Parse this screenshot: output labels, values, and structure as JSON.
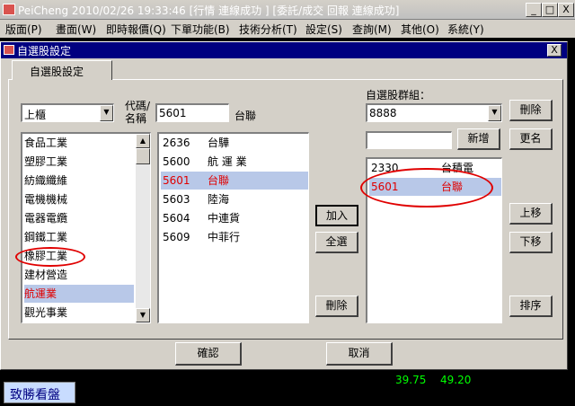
{
  "app": {
    "title": "PeiCheng 2010/02/26 19:33:46 [行情  連線成功 ] [委託/成交 回報  連線成功]",
    "minimize": "_",
    "maximize": "□",
    "close": "X"
  },
  "menu": [
    "版面(P)",
    "畫面(W)",
    "即時報價(Q)",
    "下單功能(B)",
    "技術分析(T)",
    "設定(S)",
    "查詢(M)",
    "其他(O)",
    "系統(Y)"
  ],
  "dialog": {
    "title": "自選股設定",
    "close": "X",
    "tab": "自選股設定",
    "market_select": "上櫃",
    "code_label_top": "代碼/",
    "code_label_bottom": "名稱",
    "code_value": "5601",
    "code_name": "台聯",
    "group_label": "自選股群組：",
    "group_value": "8888",
    "new_group_input": "",
    "industries": [
      "食品工業",
      "塑膠工業",
      "紡織纖維",
      "電機機械",
      "電器電纜",
      "鋼鐵工業",
      "橡膠工業",
      "建材營造",
      "航運業",
      "觀光事業"
    ],
    "stocks": [
      {
        "code": "2636",
        "name": "台驊"
      },
      {
        "code": "5600",
        "name": "航 運 業"
      },
      {
        "code": "5601",
        "name": "台聯"
      },
      {
        "code": "5603",
        "name": "陸海"
      },
      {
        "code": "5604",
        "name": "中連貨"
      },
      {
        "code": "5609",
        "name": "中菲行"
      }
    ],
    "group_stocks": [
      {
        "code": "2330",
        "name": "台積電"
      },
      {
        "code": "5601",
        "name": "台聯"
      }
    ],
    "buttons": {
      "add": "加入",
      "select_all": "全選",
      "remove": "刪除",
      "delete_group": "刪除",
      "new_group": "新增",
      "rename": "更名",
      "move_up": "上移",
      "move_down": "下移",
      "sort": "排序",
      "ok": "確認",
      "cancel": "取消"
    }
  },
  "bottom": {
    "tab": "致勝看盤",
    "num1": "39.75",
    "num2": "49.20"
  },
  "colors": {
    "title_bar": "#000080",
    "selection": "#b8c8e8",
    "highlight_red": "#e00000",
    "annotation": "#e00000"
  }
}
